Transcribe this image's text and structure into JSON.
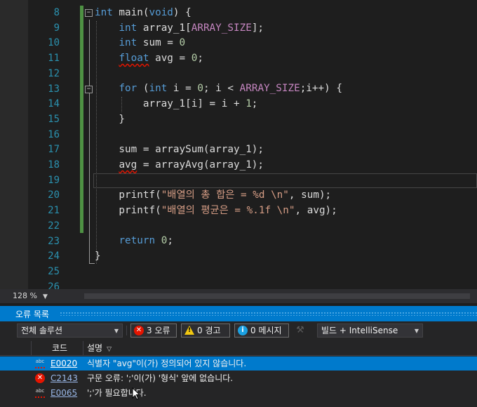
{
  "editor": {
    "line_numbers": [
      "8",
      "9",
      "10",
      "11",
      "12",
      "13",
      "14",
      "15",
      "16",
      "17",
      "18",
      "19",
      "20",
      "21",
      "22",
      "23",
      "24",
      "25",
      "26"
    ],
    "code_lines": [
      [
        {
          "t": "int",
          "c": "kw"
        },
        {
          "t": " main(",
          "c": ""
        },
        {
          "t": "void",
          "c": "kw"
        },
        {
          "t": ") {",
          "c": ""
        }
      ],
      [
        {
          "t": "    ",
          "c": ""
        },
        {
          "t": "int",
          "c": "kw"
        },
        {
          "t": " array_1[",
          "c": ""
        },
        {
          "t": "ARRAY_SIZE",
          "c": "mac"
        },
        {
          "t": "];",
          "c": ""
        }
      ],
      [
        {
          "t": "    ",
          "c": ""
        },
        {
          "t": "int",
          "c": "kw"
        },
        {
          "t": " sum = ",
          "c": ""
        },
        {
          "t": "0",
          "c": "num"
        }
      ],
      [
        {
          "t": "    ",
          "c": ""
        },
        {
          "t": "float",
          "c": "kw squig"
        },
        {
          "t": " avg = ",
          "c": ""
        },
        {
          "t": "0",
          "c": "num"
        },
        {
          "t": ";",
          "c": ""
        }
      ],
      [
        {
          "t": "",
          "c": ""
        }
      ],
      [
        {
          "t": "    ",
          "c": ""
        },
        {
          "t": "for",
          "c": "kw"
        },
        {
          "t": " (",
          "c": ""
        },
        {
          "t": "int",
          "c": "kw"
        },
        {
          "t": " i = ",
          "c": ""
        },
        {
          "t": "0",
          "c": "num"
        },
        {
          "t": "; i < ",
          "c": ""
        },
        {
          "t": "ARRAY_SIZE",
          "c": "mac"
        },
        {
          "t": ";i++) {",
          "c": ""
        }
      ],
      [
        {
          "t": "        array_1[i] = i + ",
          "c": ""
        },
        {
          "t": "1",
          "c": "num"
        },
        {
          "t": ";",
          "c": ""
        }
      ],
      [
        {
          "t": "    }",
          "c": ""
        }
      ],
      [
        {
          "t": "",
          "c": ""
        }
      ],
      [
        {
          "t": "    sum = arraySum(array_1);",
          "c": ""
        }
      ],
      [
        {
          "t": "    ",
          "c": ""
        },
        {
          "t": "avg",
          "c": "squig"
        },
        {
          "t": " = arrayAvg(array_1);",
          "c": ""
        }
      ],
      [
        {
          "t": "",
          "c": ""
        }
      ],
      [
        {
          "t": "    printf(",
          "c": ""
        },
        {
          "t": "\"배열의 총 합은 = %d \\n\"",
          "c": "str"
        },
        {
          "t": ", sum);",
          "c": ""
        }
      ],
      [
        {
          "t": "    printf(",
          "c": ""
        },
        {
          "t": "\"배열의 평균은 = %.1f \\n\"",
          "c": "str"
        },
        {
          "t": ", avg);",
          "c": ""
        }
      ],
      [
        {
          "t": "",
          "c": ""
        }
      ],
      [
        {
          "t": "    ",
          "c": ""
        },
        {
          "t": "return",
          "c": "kw"
        },
        {
          "t": " ",
          "c": ""
        },
        {
          "t": "0",
          "c": "num"
        },
        {
          "t": ";",
          "c": ""
        }
      ],
      [
        {
          "t": "}",
          "c": ""
        }
      ],
      [
        {
          "t": "",
          "c": ""
        }
      ],
      [
        {
          "t": "",
          "c": ""
        }
      ]
    ]
  },
  "zoom": {
    "level": "128 %"
  },
  "error_list": {
    "title": "오류 목록",
    "scope": "전체 솔루션",
    "errors_label": "3 오류",
    "warnings_label": "0 경고",
    "messages_label": "0 메시지",
    "build_filter": "빌드 + IntelliSense",
    "col_code": "코드",
    "col_desc": "설명",
    "rows": [
      {
        "icon": "intellisense-error-icon",
        "code": "E0020",
        "desc": "식별자 \"avg\"이(가) 정의되어 있지 않습니다."
      },
      {
        "icon": "build-error-icon",
        "code": "C2143",
        "desc": "구문 오류: ';'이(가) '형식' 앞에 없습니다."
      },
      {
        "icon": "intellisense-error-icon",
        "code": "E0065",
        "desc": "';'가 필요합니다."
      }
    ]
  },
  "colors": {
    "accent": "#007acc",
    "error": "#e51400",
    "change_bar": "#57a64a"
  }
}
